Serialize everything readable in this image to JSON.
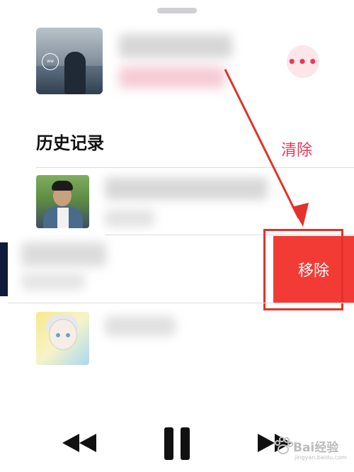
{
  "now_playing": {
    "artwork_icon": "album-artwork",
    "more_icon": "more-dots-icon",
    "more_label": "•••"
  },
  "history": {
    "title": "历史记录",
    "clear_label": "清除",
    "items": [
      {
        "thumb_icon": "artist-photo"
      },
      {
        "thumb_icon": "artwork-partial",
        "swipe_action_label": "移除"
      },
      {
        "thumb_icon": "anime-artwork"
      }
    ]
  },
  "controls": {
    "previous_icon": "rewind-icon",
    "pause_icon": "pause-icon",
    "next_icon": "fast-forward-icon"
  },
  "watermark": {
    "text": "Bai经验",
    "url": "jingyan.baidu.com"
  },
  "colors": {
    "accent": "#e8395b",
    "remove": "#f23b35",
    "annotation": "#e4312c"
  }
}
